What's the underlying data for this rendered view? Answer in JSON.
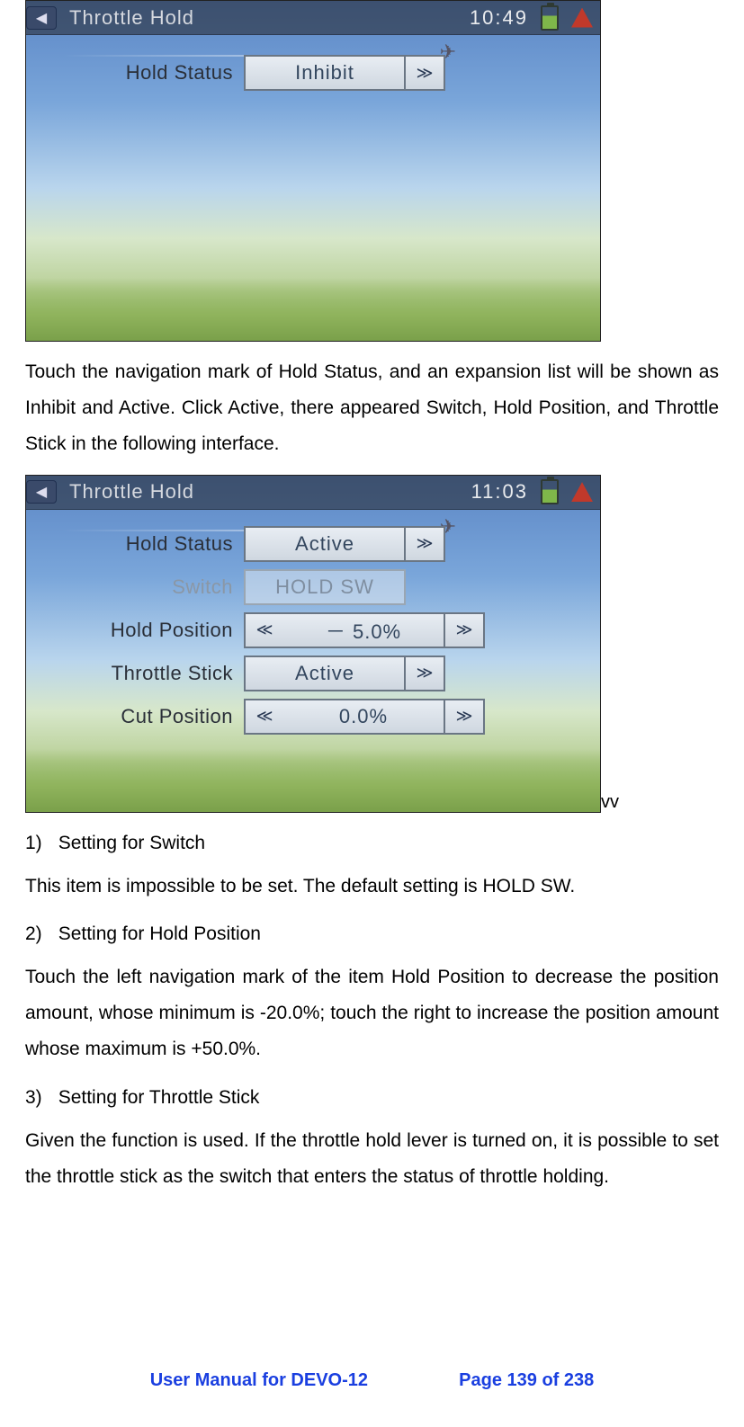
{
  "screen1": {
    "title": "Throttle Hold",
    "clock": "10:49",
    "row_label": "Hold Status",
    "row_value": "Inhibit"
  },
  "para1": "Touch the navigation mark of Hold Status, and an expansion list will be shown as Inhibit and Active. Click Active, there appeared Switch, Hold Position, and Throttle Stick in the following interface.",
  "screen2": {
    "title": "Throttle Hold",
    "clock": "11:03",
    "rows": {
      "hold_status": {
        "label": "Hold Status",
        "value": "Active"
      },
      "switch": {
        "label": "Switch",
        "value": "HOLD SW"
      },
      "hold_pos": {
        "label": "Hold Position",
        "value": "－ 5.0%"
      },
      "thr_stick": {
        "label": "Throttle Stick",
        "value": "Active"
      },
      "cut_pos": {
        "label": "Cut Position",
        "value": "0.0%"
      }
    }
  },
  "vv": "vv",
  "sec1_head_num": "1)",
  "sec1_head": "Setting for Switch",
  "sec1_body": "This item is impossible to be set. The default setting is HOLD SW.",
  "sec2_head_num": "2)",
  "sec2_head": "Setting for Hold Position",
  "sec2_body": "Touch the left navigation mark of the item Hold Position to decrease the position amount, whose minimum is -20.0%; touch the right to increase the position amount whose maximum is +50.0%.",
  "sec3_head_num": "3)",
  "sec3_head": "Setting for Throttle Stick",
  "sec3_body": "Given the function is used. If the throttle hold lever is turned on, it is possible to set the throttle stick as the switch that enters the status of throttle holding.",
  "footer_left": "User Manual for DEVO-12",
  "footer_right": "Page 139 of 238"
}
